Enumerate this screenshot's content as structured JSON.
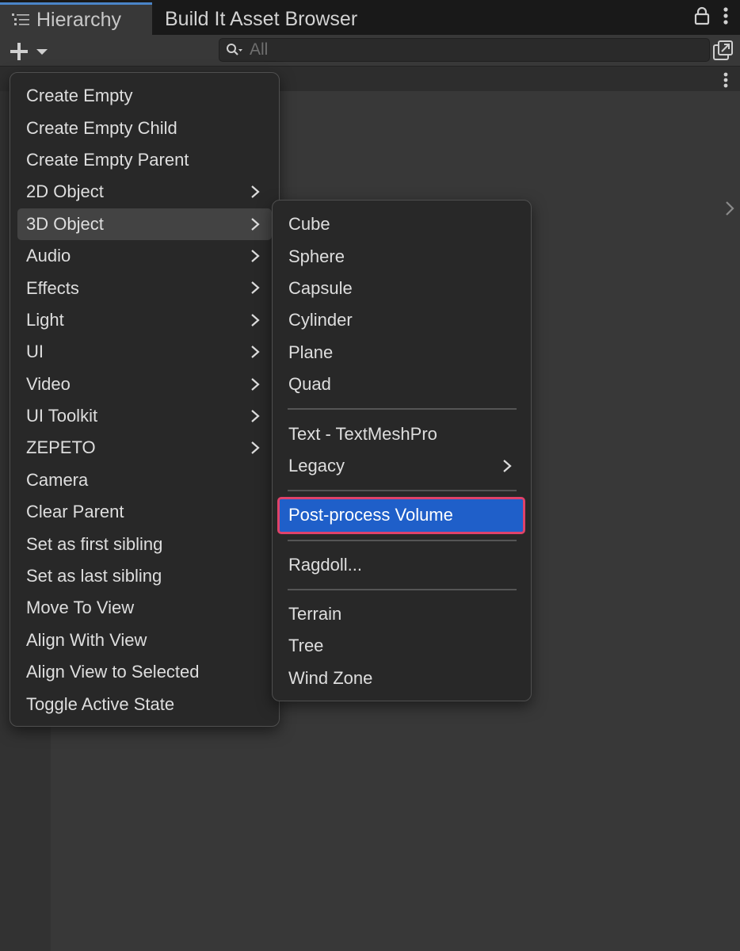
{
  "tabs": {
    "hierarchy": "Hierarchy",
    "asset_browser": "Build It Asset Browser"
  },
  "toolbar": {
    "search_placeholder": "All"
  },
  "main_menu": {
    "items": [
      {
        "label": "Create Empty",
        "has_submenu": false
      },
      {
        "label": "Create Empty Child",
        "has_submenu": false
      },
      {
        "label": "Create Empty Parent",
        "has_submenu": false
      },
      {
        "label": "2D Object",
        "has_submenu": true
      },
      {
        "label": "3D Object",
        "has_submenu": true,
        "highlighted": true
      },
      {
        "label": "Audio",
        "has_submenu": true
      },
      {
        "label": "Effects",
        "has_submenu": true
      },
      {
        "label": "Light",
        "has_submenu": true
      },
      {
        "label": "UI",
        "has_submenu": true
      },
      {
        "label": "Video",
        "has_submenu": true
      },
      {
        "label": "UI Toolkit",
        "has_submenu": true
      },
      {
        "label": "ZEPETO",
        "has_submenu": true
      },
      {
        "label": "Camera",
        "has_submenu": false
      },
      {
        "label": "Clear Parent",
        "has_submenu": false
      },
      {
        "label": "Set as first sibling",
        "has_submenu": false
      },
      {
        "label": "Set as last sibling",
        "has_submenu": false
      },
      {
        "label": "Move To View",
        "has_submenu": false
      },
      {
        "label": "Align With View",
        "has_submenu": false
      },
      {
        "label": "Align View to Selected",
        "has_submenu": false
      },
      {
        "label": "Toggle Active State",
        "has_submenu": false
      }
    ]
  },
  "submenu_3d": {
    "group1": [
      "Cube",
      "Sphere",
      "Capsule",
      "Cylinder",
      "Plane",
      "Quad"
    ],
    "group2": [
      "Text - TextMeshPro",
      "Legacy"
    ],
    "selected": "Post-process Volume",
    "group3": [
      "Ragdoll..."
    ],
    "group4": [
      "Terrain",
      "Tree",
      "Wind Zone"
    ]
  },
  "colors": {
    "selected_bg": "#1f5fc9",
    "highlight_outline": "#e0426a",
    "tab_accent": "#4a84c8"
  }
}
